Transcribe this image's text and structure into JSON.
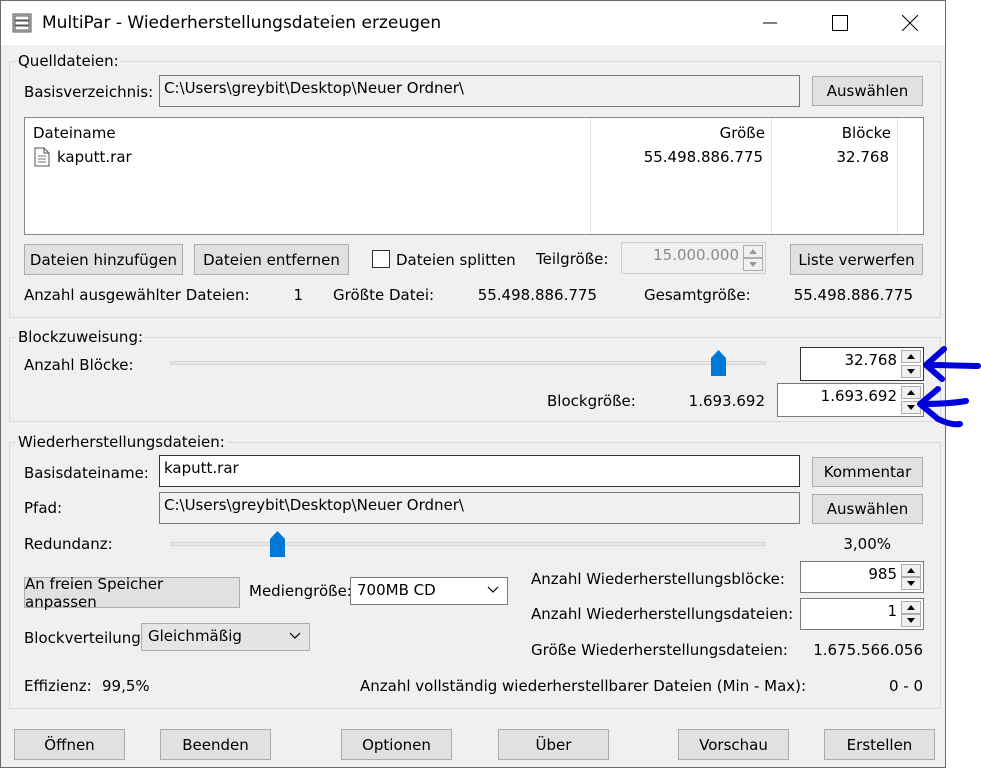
{
  "window": {
    "title": "MultiPar - Wiederherstellungsdateien erzeugen",
    "icons": {
      "app": "archive-icon",
      "minimize": "minimize-icon",
      "maximize": "maximize-icon",
      "close": "close-icon"
    }
  },
  "source": {
    "group_label": "Quelldateien:",
    "base_dir_label": "Basisverzeichnis:",
    "base_dir_value": "C:\\Users\\greybit\\Desktop\\Neuer Ordner\\",
    "select_button": "Auswählen",
    "columns": {
      "name": "Dateiname",
      "size": "Größe",
      "blocks": "Blöcke"
    },
    "files": [
      {
        "name": "kaputt.rar",
        "size": "55.498.886.775",
        "blocks": "32.768",
        "icon": "document-icon"
      }
    ],
    "add_files_button": "Dateien hinzufügen",
    "remove_files_button": "Dateien entfernen",
    "split_files_label": "Dateien splitten",
    "split_files_checked": false,
    "part_size_label": "Teilgröße:",
    "part_size_value": "15.000.000",
    "discard_list_button": "Liste verwerfen",
    "selected_count_label": "Anzahl ausgewählter Dateien:",
    "selected_count_value": "1",
    "largest_file_label": "Größte Datei:",
    "largest_file_value": "55.498.886.775",
    "total_size_label": "Gesamtgröße:",
    "total_size_value": "55.498.886.775"
  },
  "blocks": {
    "group_label": "Blockzuweisung:",
    "count_label": "Anzahl Blöcke:",
    "count_value": "32.768",
    "slider_fraction": 0.92,
    "block_size_label": "Blockgröße:",
    "block_size_display": "1.693.692",
    "block_size_value": "1.693.692"
  },
  "recovery": {
    "group_label": "Wiederherstellungsdateien:",
    "base_name_label": "Basisdateiname:",
    "base_name_value": "kaputt.rar",
    "comment_button": "Kommentar",
    "path_label": "Pfad:",
    "path_value": "C:\\Users\\greybit\\Desktop\\Neuer Ordner\\",
    "select_button": "Auswählen",
    "redundancy_label": "Redundanz:",
    "redundancy_value": "3,00%",
    "redundancy_fraction": 0.18,
    "fit_button": "An freien Speicher anpassen",
    "media_size_label": "Mediengröße:",
    "media_size_value": "700MB CD",
    "recovery_blocks_label": "Anzahl Wiederherstellungsblöcke:",
    "recovery_blocks_value": "985",
    "recovery_files_label": "Anzahl Wiederherstellungsdateien:",
    "recovery_files_value": "1",
    "block_distribution_label": "Blockverteilung:",
    "block_distribution_value": "Gleichmäßig",
    "recovery_size_label": "Größe Wiederherstellungsdateien:",
    "recovery_size_value": "1.675.566.056",
    "efficiency_label": "Effizienz:",
    "efficiency_value": "99,5%",
    "recoverable_label": "Anzahl vollständig wiederherstellbarer Dateien (Min - Max):",
    "recoverable_value": "0 - 0"
  },
  "footer": {
    "open": "Öffnen",
    "quit": "Beenden",
    "options": "Optionen",
    "about": "Über",
    "preview": "Vorschau",
    "create": "Erstellen"
  },
  "colors": {
    "window_bg": "#f0f0f0",
    "accent": "#0078d7",
    "annotation": "#0000dd"
  }
}
